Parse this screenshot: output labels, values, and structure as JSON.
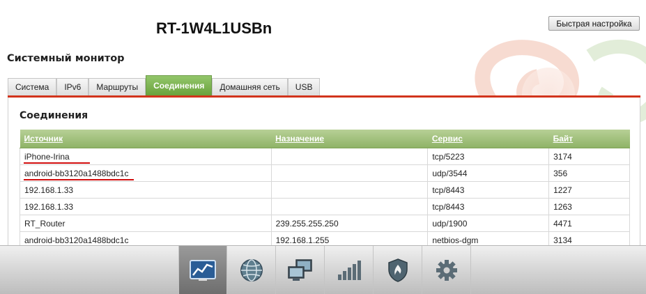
{
  "header": {
    "product_title": "RT-1W4L1USBn",
    "quick_setup_label": "Быстрая настройка"
  },
  "page": {
    "title": "Системный монитор"
  },
  "tabs": [
    {
      "label": "Система",
      "active": false
    },
    {
      "label": "IPv6",
      "active": false
    },
    {
      "label": "Маршруты",
      "active": false
    },
    {
      "label": "Соединения",
      "active": true
    },
    {
      "label": "Домашняя сеть",
      "active": false
    },
    {
      "label": "USB",
      "active": false
    }
  ],
  "connections": {
    "title": "Соединения",
    "columns": [
      "Источник",
      "Назначение",
      "Сервис",
      "Байт"
    ],
    "rows": [
      {
        "source": "iPhone-Irina",
        "destination": "",
        "service": "tcp/5223",
        "bytes": "3174",
        "highlighted": true
      },
      {
        "source": "android-bb3120a1488bdc1c",
        "destination": "",
        "service": "udp/3544",
        "bytes": "356",
        "highlighted": true
      },
      {
        "source": "192.168.1.33",
        "destination": "",
        "service": "tcp/8443",
        "bytes": "1227",
        "highlighted": false
      },
      {
        "source": "192.168.1.33",
        "destination": "",
        "service": "tcp/8443",
        "bytes": "1263",
        "highlighted": false
      },
      {
        "source": "RT_Router",
        "destination": "239.255.255.250",
        "service": "udp/1900",
        "bytes": "4471",
        "highlighted": false
      },
      {
        "source": "android-bb3120a1488bdc1c",
        "destination": "192.168.1.255",
        "service": "netbios-dgm",
        "bytes": "3134",
        "highlighted": false
      }
    ]
  },
  "dock": {
    "items": [
      {
        "icon": "monitor-chart-icon",
        "active": true
      },
      {
        "icon": "globe-icon",
        "active": false
      },
      {
        "icon": "computers-icon",
        "active": false
      },
      {
        "icon": "signal-bars-icon",
        "active": false
      },
      {
        "icon": "shield-icon",
        "active": false
      },
      {
        "icon": "gear-icon",
        "active": false
      }
    ]
  },
  "colors": {
    "accent_green": "#7aae4c",
    "accent_red": "#d2341c",
    "highlight_underline": "#d10d0d"
  }
}
